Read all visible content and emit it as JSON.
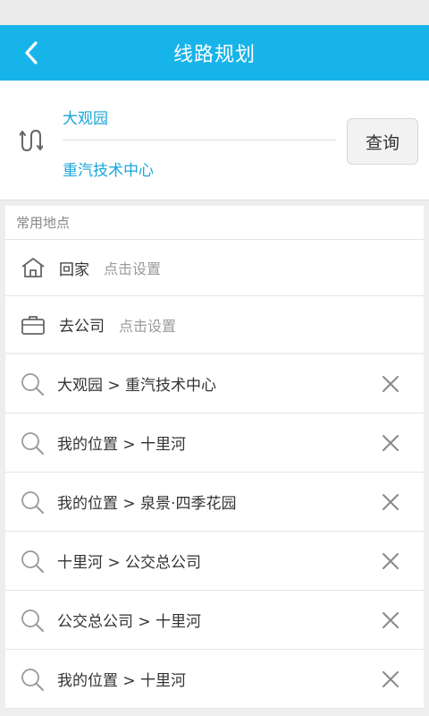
{
  "header": {
    "title": "线路规划"
  },
  "route": {
    "from": "大观园",
    "to": "重汽技术中心",
    "query_label": "查询"
  },
  "favorites": {
    "title": "常用地点",
    "items": [
      {
        "icon": "home-icon",
        "name": "回家",
        "hint": "点击设置"
      },
      {
        "icon": "briefcase-icon",
        "name": "去公司",
        "hint": "点击设置"
      }
    ]
  },
  "history": [
    {
      "text": "大观园 > 重汽技术中心"
    },
    {
      "text": "我的位置 > 十里河"
    },
    {
      "text": "我的位置 > 泉景·四季花园"
    },
    {
      "text": "十里河 > 公交总公司"
    },
    {
      "text": "公交总公司 > 十里河"
    },
    {
      "text": "我的位置 > 十里河"
    }
  ],
  "colors": {
    "header": "#17b4ea",
    "accent_text": "#1aa6d8"
  }
}
